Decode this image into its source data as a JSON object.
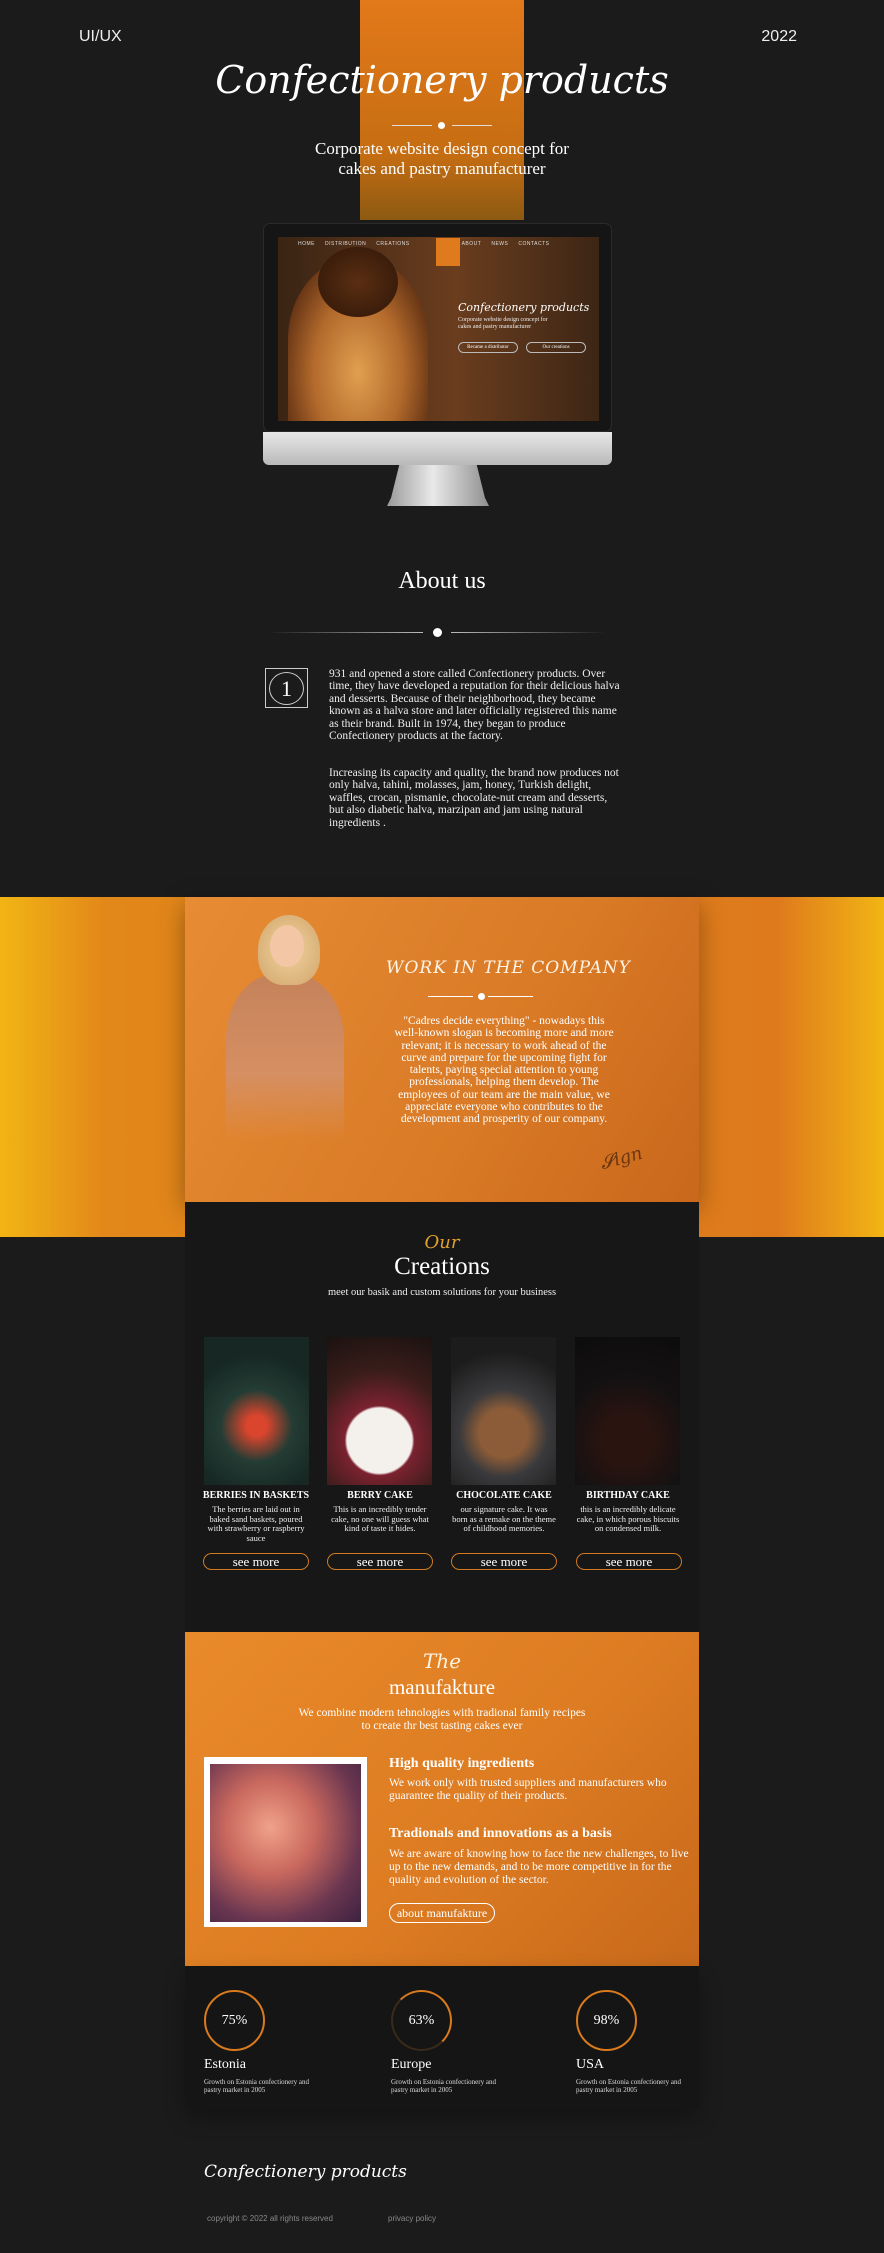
{
  "header": {
    "left_tag": "UI/UX",
    "right_tag": "2022",
    "title": "Confectionery products",
    "subtitle_line1": "Corporate website design concept for",
    "subtitle_line2": "cakes and pastry manufacturer"
  },
  "mockup": {
    "nav": [
      "HOME",
      "DISTRIBUTION",
      "CREATIONS",
      "ABOUT",
      "NEWS",
      "CONTACTS"
    ],
    "title": "Confectionery products",
    "subtitle": "Corporate website design concept for cakes and pastry manufacturer",
    "btn1": "Became a distributor",
    "btn2": "Our creations"
  },
  "about": {
    "title": "About us",
    "number": "1",
    "p1": "931 and opened a store called Confectionery products. Over time, they have developed a reputation for their delicious halva and desserts. Because of their neighborhood, they became known as a halva store and later officially registered this name as their brand. Built in 1974, they began to produce Confectionery products at the factory.",
    "p2": "Increasing its capacity and quality, the brand now produces not only halva, tahini, molasses, jam, honey, Turkish delight, waffles, crocan, pismanie, chocolate-nut cream and desserts, but also diabetic halva, marzipan and jam using natural ingredients ."
  },
  "work": {
    "title": "WORK IN THE COMPANY",
    "quote": "\"Cadres decide everything\" - nowadays this well-known slogan is becoming more and more relevant; it is necessary to work ahead of the curve and prepare for the upcoming fight for talents, paying special attention to young professionals, helping them develop. The employees of our team are the main value, we appreciate everyone who contributes to the development and prosperity of our company."
  },
  "creations": {
    "our": "Our",
    "title": "Creations",
    "subtitle": "meet our basik and custom solutions for your business",
    "items": [
      {
        "title": "BERRIES IN BASKETS",
        "desc": "The berries are laid out in baked sand baskets, poured with strawberry or raspberry sauce",
        "button": "see more"
      },
      {
        "title": "BERRY CAKE",
        "desc": "This is an incredibly tender cake, no one will guess what kind of taste it hides.",
        "button": "see more"
      },
      {
        "title": "CHOCOLATE CAKE",
        "desc": "our signature cake. It was born as a remake on the theme of childhood memories.",
        "button": "see more"
      },
      {
        "title": "BIRTHDAY CAKE",
        "desc": "this is an incredibly delicate cake, in which porous biscuits on condensed milk.",
        "button": "see more"
      }
    ]
  },
  "manufaktur": {
    "the": "The",
    "title": "manufakture",
    "subtitle_line1": "We combine modern tehnologies with tradional family recipes",
    "subtitle_line2": "to create thr best tasting cakes ever",
    "h1": "High quality ingredients",
    "p1": "We work only with trusted suppliers and manufacturers who guarantee the quality of their products.",
    "h2": "Tradionals and innovations as  a basis",
    "p2": "We are aware of knowing how to face the new challenges, to live up to the new demands, and to be more competitive in for the quality and evolution of the sector.",
    "button": "about manufakture"
  },
  "stats": [
    {
      "value": "75%",
      "name": "Estonia",
      "desc": "Growth on Estonia confectionery and pastry market in 2005"
    },
    {
      "value": "63%",
      "name": "Europe",
      "desc": "Growth on Estonia confectionery and pastry market in 2005"
    },
    {
      "value": "98%",
      "name": "USA",
      "desc": "Growth on Estonia confectionery and pastry market in 2005"
    }
  ],
  "footer": {
    "logo": "Confectionery products",
    "copyright": "copyright © 2022 all rights reserved",
    "privacy": "privacy policy"
  }
}
